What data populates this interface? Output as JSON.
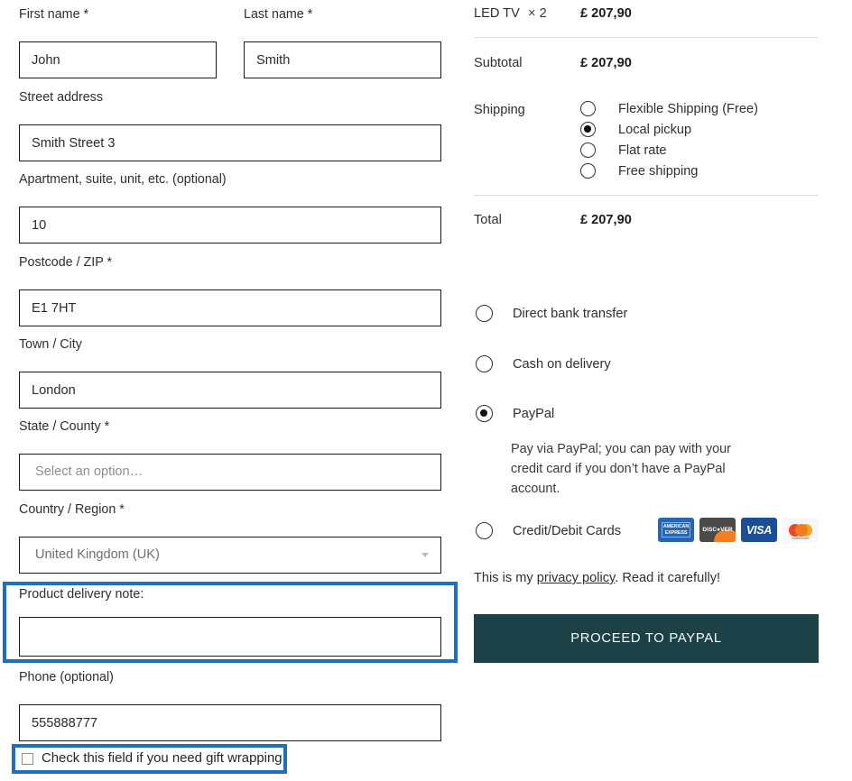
{
  "colors": {
    "highlight_blue": "#1f6fc0",
    "button_teal": "#1c4247",
    "field_border": "#1a1a1a",
    "divider": "#dcdcdc"
  },
  "billing": {
    "first_name": {
      "label": "First name *",
      "value": "John"
    },
    "last_name": {
      "label": "Last name *",
      "value": "Smith"
    },
    "street_address": {
      "label": "Street address",
      "value": "Smith Street 3"
    },
    "apartment": {
      "label": "Apartment, suite, unit, etc. (optional)",
      "value": "10"
    },
    "postcode": {
      "label": "Postcode / ZIP *",
      "value": "E1 7HT"
    },
    "town_city": {
      "label": "Town / City",
      "value": "London"
    },
    "state_county": {
      "label": "State / County  *",
      "value": "",
      "placeholder": "Select an option…"
    },
    "country_region": {
      "label": "Country / Region *",
      "value": "United Kingdom (UK)"
    },
    "delivery_note": {
      "label": "Product delivery note:",
      "value": "",
      "highlighted": true
    },
    "phone": {
      "label": "Phone (optional)",
      "value": "555888777"
    },
    "gift_wrapping": {
      "label": "Check this field if you need gift wrapping",
      "checked": false,
      "highlighted": true
    }
  },
  "order_review": {
    "line_item": {
      "name": "LED TV",
      "qty": "× 2",
      "price": "£ 207,90"
    },
    "subtotal": {
      "label": "Subtotal",
      "value": "£ 207,90"
    },
    "shipping": {
      "label": "Shipping",
      "options": [
        {
          "label": "Flexible Shipping (Free)",
          "selected": false
        },
        {
          "label": "Local pickup",
          "selected": true
        },
        {
          "label": "Flat rate",
          "selected": false
        },
        {
          "label": "Free shipping",
          "selected": false
        }
      ]
    },
    "total": {
      "label": "Total",
      "value": "£ 207,90"
    }
  },
  "payment": {
    "methods": [
      {
        "label": "Direct bank transfer",
        "selected": false
      },
      {
        "label": "Cash on delivery",
        "selected": false
      },
      {
        "label": "PayPal",
        "selected": true
      },
      {
        "label": "Credit/Debit Cards",
        "selected": false
      }
    ],
    "paypal_description": "Pay via PayPal; you can pay with your credit card if you don’t have a PayPal account.",
    "card_logos": [
      {
        "name": "amex-logo",
        "line1": "AMERICAN",
        "line2": "EXPRESS"
      },
      {
        "name": "discover-logo",
        "text": "DISC●VER"
      },
      {
        "name": "visa-logo",
        "text": "VISA"
      },
      {
        "name": "mastercard-logo",
        "text": "mastercard"
      }
    ],
    "privacy": {
      "prefix": "This is my ",
      "link": "privacy policy",
      "suffix": ". Read it carefully!"
    },
    "submit_label": "PROCEED TO PAYPAL"
  }
}
